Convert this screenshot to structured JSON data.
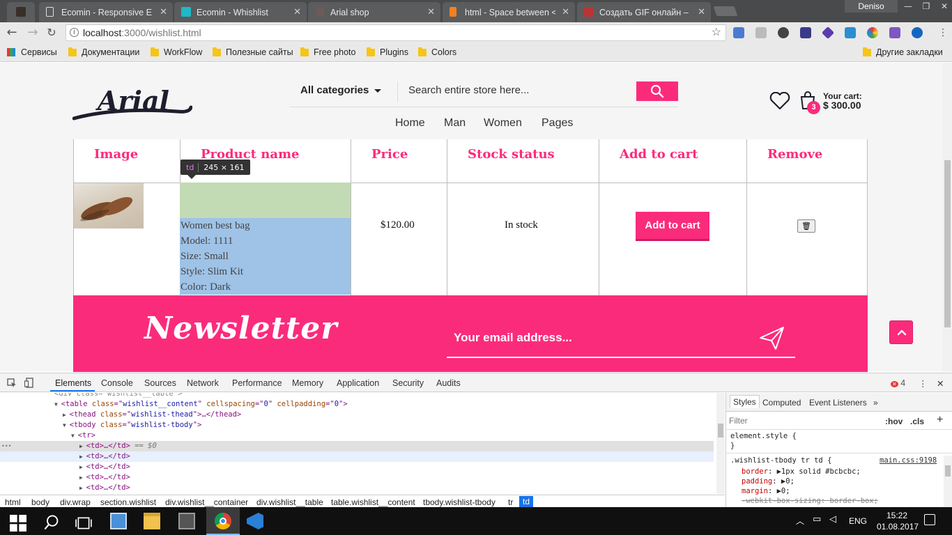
{
  "browser": {
    "tabs": [
      {
        "label": ""
      },
      {
        "label": "Ecomin - Responsive Ecom"
      },
      {
        "label": "Ecomin - Whishlist"
      },
      {
        "label": "Arial shop"
      },
      {
        "label": "html - Space between <t"
      },
      {
        "label": "Создать GIF онлайн – со"
      }
    ],
    "active_tab_index": 4,
    "profile": "Deniso",
    "url_host": "localhost",
    "url_path": ":3000/wishlist.html",
    "bookmarks": [
      {
        "label": "Сервисы"
      },
      {
        "label": "Документации"
      },
      {
        "label": "WorkFlow"
      },
      {
        "label": "Полезные сайты"
      },
      {
        "label": "Free photo"
      },
      {
        "label": "Plugins"
      },
      {
        "label": "Colors"
      }
    ],
    "other_bookmarks": "Другие закладки"
  },
  "header": {
    "logo_text": "Arial",
    "category_select": "All categories",
    "search_placeholder": "Search entire store here...",
    "menu": [
      "Home",
      "Man",
      "Women",
      "Pages"
    ],
    "cart_count": "3",
    "cart_label": "Your cart:",
    "cart_total": "$ 300.00"
  },
  "wishlist": {
    "columns": [
      "Image",
      "Product name",
      "Price",
      "Stock status",
      "Add to cart",
      "Remove"
    ],
    "row": {
      "product_lines": [
        "Women best bag",
        "Model: 1111",
        "Size: Small",
        "Style: Slim Kit",
        "Color: Dark"
      ],
      "price": "$120.00",
      "stock": "In stock",
      "add_to_cart": "Add to cart"
    }
  },
  "inspector_tooltip": {
    "tag": "td",
    "size": "245 × 161"
  },
  "newsletter": {
    "title": "Newsletter",
    "email_placeholder": "Your email address..."
  },
  "devtools": {
    "tabs": [
      "Elements",
      "Console",
      "Sources",
      "Network",
      "Performance",
      "Memory",
      "Application",
      "Security",
      "Audits"
    ],
    "error_count": "4",
    "dom_lines": [
      {
        "indent": 78,
        "arrow": "▼",
        "html": "<table class=\"wishlist__content\" cellspacing=\"0\" cellpadding=\"0\">"
      },
      {
        "indent": 90,
        "arrow": "▶",
        "html": "<thead class=\"wishlist-thead\">…</thead>"
      },
      {
        "indent": 90,
        "arrow": "▼",
        "html": "<tbody class=\"wishlist-tbody\">"
      },
      {
        "indent": 102,
        "arrow": "▼",
        "html": "<tr>"
      },
      {
        "indent": 114,
        "arrow": "▶",
        "html": "<td>…</td> == $0"
      },
      {
        "indent": 114,
        "arrow": "▶",
        "html": "<td>…</td>"
      },
      {
        "indent": 114,
        "arrow": "▶",
        "html": "<td>…</td>"
      },
      {
        "indent": 114,
        "arrow": "▶",
        "html": "<td>…</td>"
      },
      {
        "indent": 114,
        "arrow": "▶",
        "html": "<td>…</td>"
      }
    ],
    "breadcrumbs": [
      "html",
      "body",
      "div.wrap",
      "section.wishlist",
      "div.wishlist__container",
      "div.wishlist__table",
      "table.wishlist__content",
      "tbody.wishlist-tbody",
      "tr",
      "td"
    ],
    "styles_tabs": [
      "Styles",
      "Computed",
      "Event Listeners"
    ],
    "filter_placeholder": "Filter",
    "hov": ":hov",
    "cls": ".cls",
    "css": {
      "element_style": "element.style {",
      "close_brace": "}",
      "rule_selector": ".wishlist-tbody tr td {",
      "rule_source": "main.css:9198",
      "props": [
        {
          "name": "border",
          "value": "1px solid #bcbcbc;",
          "struck": false
        },
        {
          "name": "padding",
          "value": "0;",
          "struck": false
        },
        {
          "name": "margin",
          "value": "0;",
          "struck": false
        },
        {
          "name": "-webkit-box-sizing",
          "value": "border-box;",
          "struck": true
        }
      ]
    }
  },
  "taskbar": {
    "lang": "ENG",
    "time": "15:22",
    "date": "01.08.2017"
  }
}
